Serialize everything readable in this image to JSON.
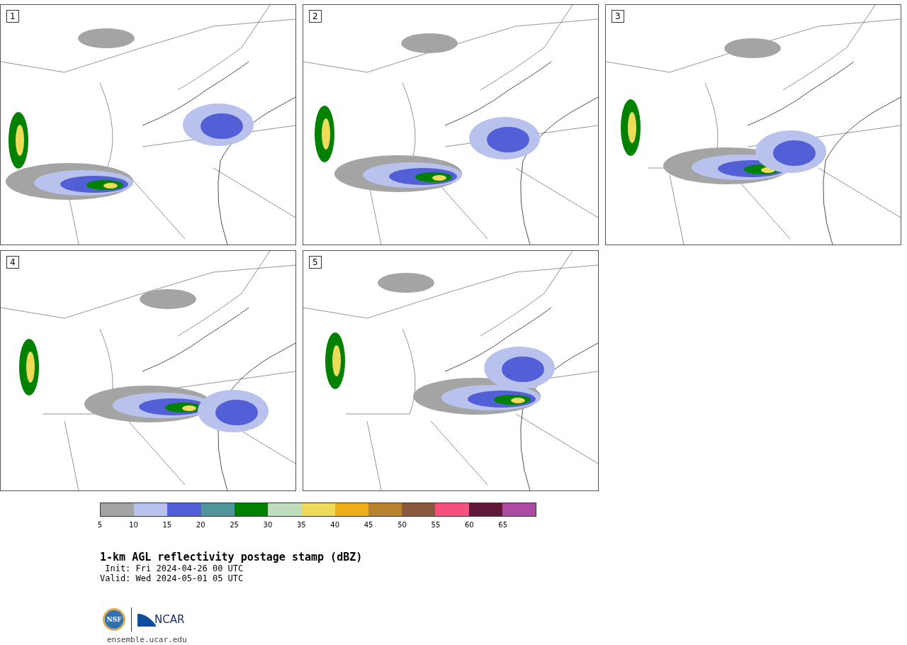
{
  "panels": [
    {
      "label": "1"
    },
    {
      "label": "2"
    },
    {
      "label": "3"
    },
    {
      "label": "4"
    },
    {
      "label": "5"
    }
  ],
  "colorbar": {
    "segments": [
      {
        "color": "#a4a4a4",
        "tick": "5"
      },
      {
        "color": "#b8c2ec",
        "tick": "10"
      },
      {
        "color": "#525fd6",
        "tick": "15"
      },
      {
        "color": "#50959a",
        "tick": "20"
      },
      {
        "color": "#008200",
        "tick": "25"
      },
      {
        "color": "#bedcbe",
        "tick": "30"
      },
      {
        "color": "#eedb5a",
        "tick": "35"
      },
      {
        "color": "#eeae18",
        "tick": "40"
      },
      {
        "color": "#b8822e",
        "tick": "45"
      },
      {
        "color": "#8a5a3e",
        "tick": "50"
      },
      {
        "color": "#f5507e",
        "tick": "55"
      },
      {
        "color": "#601838",
        "tick": "60"
      },
      {
        "color": "#ac4ca4",
        "tick": "65"
      }
    ]
  },
  "title": "1-km AGL reflectivity postage stamp (dBZ)",
  "init": " Init: Fri 2024-04-26 00 UTC",
  "valid": "Valid: Wed 2024-05-01 05 UTC",
  "logo": {
    "nsf": "NSF",
    "ncar": "NCAR"
  },
  "url": "ensemble.ucar.edu"
}
